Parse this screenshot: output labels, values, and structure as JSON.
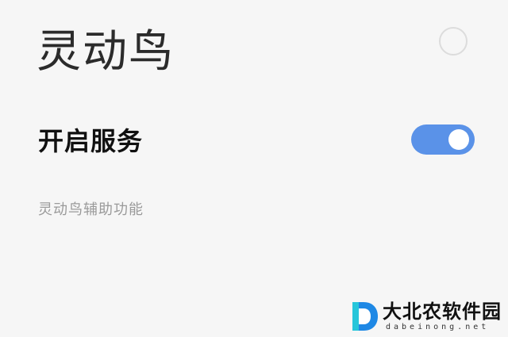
{
  "header": {
    "title": "灵动鸟"
  },
  "settings": {
    "service_label": "开启服务",
    "service_enabled": true,
    "description": "灵动鸟辅助功能"
  },
  "colors": {
    "background": "#f6f6f6",
    "toggle_on": "#5a92e8",
    "title_text": "#2b2b2b",
    "description_text": "#9a9a9a"
  },
  "icons": {
    "toggle": "toggle-switch-on"
  },
  "watermark": {
    "name": "大北农软件园",
    "url": "dabeinong.net",
    "logo": "letter-d-logo"
  }
}
